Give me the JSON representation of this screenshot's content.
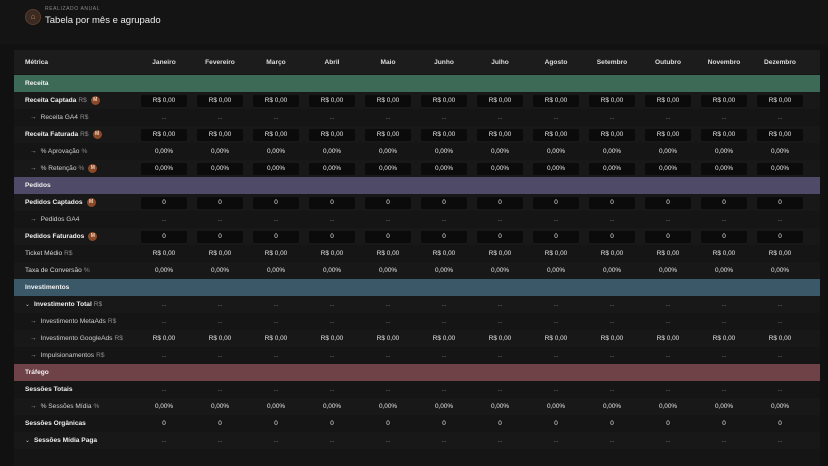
{
  "header": {
    "kicker": "REALIZADO ANUAL",
    "title": "Tabela por mês e agrupado",
    "logo_icon": "house-icon"
  },
  "table": {
    "metric_header": "Métrica",
    "months": [
      "Janeiro",
      "Fevereiro",
      "Março",
      "Abril",
      "Maio",
      "Junho",
      "Julho",
      "Agosto",
      "Setembro",
      "Outubro",
      "Novembro",
      "Dezembro"
    ],
    "rows": [
      {
        "type": "section",
        "label": "Receita",
        "color": "#3c6a57"
      },
      {
        "type": "bold",
        "label": "Receita Captada",
        "unit": "R$",
        "badge": "M",
        "value": "R$ 0,00",
        "input": true
      },
      {
        "type": "sub",
        "label": "Receita GA4",
        "unit": "R$",
        "value": "...",
        "input": false
      },
      {
        "type": "bold",
        "label": "Receita Faturada",
        "unit": "R$",
        "badge": "M",
        "value": "R$ 0,00",
        "input": true
      },
      {
        "type": "sub",
        "label": "% Aprovação",
        "unit": "%",
        "value": "0,00%",
        "input": false
      },
      {
        "type": "sub",
        "label": "% Retenção",
        "unit": "%",
        "badge": "M",
        "value": "0,00%",
        "input": true
      },
      {
        "type": "section",
        "label": "Pedidos",
        "color": "#4f4a68"
      },
      {
        "type": "bold",
        "label": "Pedidos Captados",
        "unit": "",
        "badge": "M",
        "value": "0",
        "input": true
      },
      {
        "type": "sub",
        "label": "Pedidos GA4",
        "unit": "",
        "value": "...",
        "input": false
      },
      {
        "type": "bold",
        "label": "Pedidos Faturados",
        "unit": "",
        "badge": "M",
        "value": "0",
        "input": true
      },
      {
        "type": "plain",
        "label": "Ticket Médio",
        "unit": "R$",
        "value": "R$ 0,00",
        "input": false
      },
      {
        "type": "plain",
        "label": "Taxa de Conversão",
        "unit": "%",
        "value": "0,00%",
        "input": false
      },
      {
        "type": "section",
        "label": "Investimentos",
        "color": "#3a5868"
      },
      {
        "type": "group",
        "label": "Investimento Total",
        "unit": "R$",
        "value": "...",
        "input": false
      },
      {
        "type": "sub",
        "label": "Investimento MetaAds",
        "unit": "R$",
        "value": "...",
        "input": false
      },
      {
        "type": "sub",
        "label": "Investimento GoogleAds",
        "unit": "R$",
        "value": "R$ 0,00",
        "input": false
      },
      {
        "type": "sub",
        "label": "Impulsionamentos",
        "unit": "R$",
        "value": "...",
        "input": false
      },
      {
        "type": "section",
        "label": "Tráfego",
        "color": "#6e4246"
      },
      {
        "type": "bold",
        "label": "Sessões Totais",
        "unit": "",
        "value": "...",
        "input": false
      },
      {
        "type": "sub",
        "label": "% Sessões Mídia",
        "unit": "%",
        "value": "0,00%",
        "input": false
      },
      {
        "type": "bold",
        "label": "Sessões Orgânicas",
        "unit": "",
        "value": "0",
        "input": false
      },
      {
        "type": "group",
        "label": "Sessões Mídia Paga",
        "unit": "",
        "value": "...",
        "input": false
      }
    ]
  }
}
